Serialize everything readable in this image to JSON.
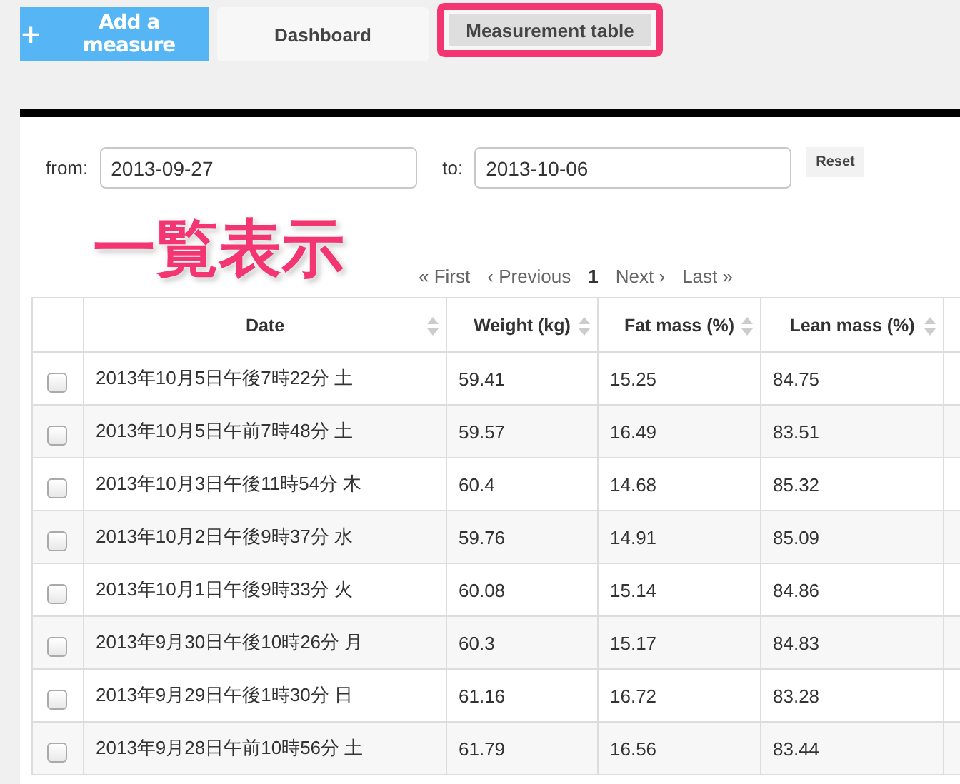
{
  "nav": {
    "add_button": {
      "icon": "+",
      "label": "Add a measure"
    },
    "tabs": [
      {
        "label": "Dashboard",
        "selected": false,
        "highlighted": false
      },
      {
        "label": "Measurement table",
        "selected": true,
        "highlighted": true
      }
    ]
  },
  "filter": {
    "from_label": "from:",
    "from_value": "2013-09-27",
    "to_label": "to:",
    "to_value": "2013-10-06",
    "reset_button": "Reset"
  },
  "annotation": "一覧表示",
  "pagination": [
    {
      "label": "« First",
      "selected": false
    },
    {
      "label": "‹ Previous",
      "selected": false
    },
    {
      "label": "1",
      "selected": true
    },
    {
      "label": "Next ›",
      "selected": false
    },
    {
      "label": "Last »",
      "selected": false
    }
  ],
  "table": {
    "columns": [
      "Date",
      "Weight (kg)",
      "Fat mass (%)",
      "Lean mass (%)"
    ],
    "rows": [
      {
        "checked": false,
        "cells": [
          "2013年10月5日午後7時22分 土",
          "59.41",
          "15.25",
          "84.75"
        ]
      },
      {
        "checked": false,
        "cells": [
          "2013年10月5日午前7時48分 土",
          "59.57",
          "16.49",
          "83.51"
        ]
      },
      {
        "checked": false,
        "cells": [
          "2013年10月3日午後11時54分 木",
          "60.4",
          "14.68",
          "85.32"
        ]
      },
      {
        "checked": false,
        "cells": [
          "2013年10月2日午後9時37分 水",
          "59.76",
          "14.91",
          "85.09"
        ]
      },
      {
        "checked": false,
        "cells": [
          "2013年10月1日午後9時33分 火",
          "60.08",
          "15.14",
          "84.86"
        ]
      },
      {
        "checked": false,
        "cells": [
          "2013年9月30日午後10時26分 月",
          "60.3",
          "15.17",
          "84.83"
        ]
      },
      {
        "checked": false,
        "cells": [
          "2013年9月29日午後1時30分 日",
          "61.16",
          "16.72",
          "83.28"
        ]
      },
      {
        "checked": false,
        "cells": [
          "2013年9月28日午前10時56分 土",
          "61.79",
          "16.56",
          "83.44"
        ]
      }
    ]
  }
}
